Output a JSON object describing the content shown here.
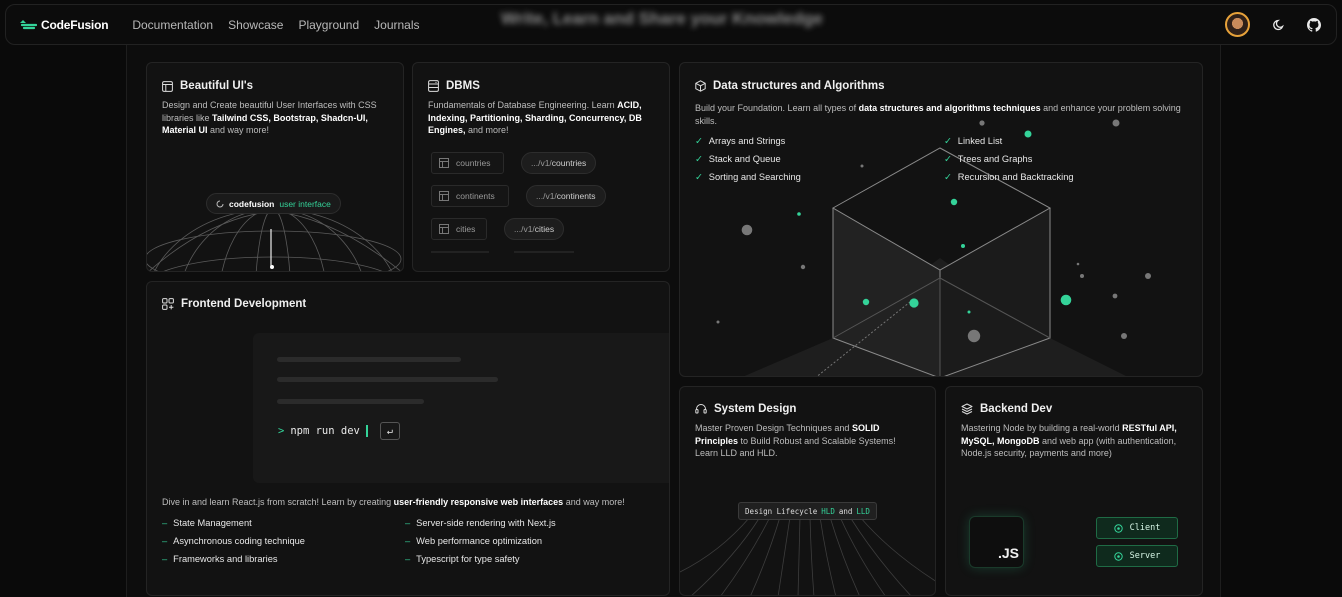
{
  "nav": {
    "brand": "CodeFusion",
    "links": [
      "Documentation",
      "Showcase",
      "Playground",
      "Journals"
    ],
    "hero_blurred": "Write, Learn and Share your Knowledge"
  },
  "cards": {
    "ui": {
      "title": "Beautiful UI's",
      "desc_pre": "Design and Create beautiful User Interfaces with CSS libraries like ",
      "desc_bold": "Tailwind CSS, Bootstrap, Shadcn-UI, Material UI",
      "desc_post": " and way more!",
      "badge_brand": "codefusion",
      "badge_accent": "user interface"
    },
    "dbms": {
      "title": "DBMS",
      "desc_pre": "Fundamentals of Database Engineering. Learn ",
      "desc_bold": "ACID, Indexing, Partitioning, Sharding, Concurrency, DB Engines,",
      "desc_post": " and more!",
      "tables": [
        "countries",
        "continents",
        "cities"
      ],
      "routes_prefix": ".../v1/",
      "routes": [
        "countries",
        "continents",
        "cities"
      ]
    },
    "dsa": {
      "title": "Data structures and Algorithms",
      "desc_pre": "Build your Foundation. Learn all types of ",
      "desc_bold": "data structures and algorithms techniques",
      "desc_post": " and enhance your problem solving skills.",
      "check": "✓",
      "topics_left": [
        "Arrays and Strings",
        "Stack and Queue",
        "Sorting and Searching"
      ],
      "topics_right": [
        "Linked List",
        "Trees and Graphs",
        "Recursion and Backtracking"
      ]
    },
    "frontend": {
      "title": "Frontend Development",
      "terminal_prompt": ">",
      "terminal_cmd": "npm run dev",
      "desc_pre": "Dive in and learn React.js from scratch! Learn by creating ",
      "desc_bold": "user-friendly responsive web interfaces",
      "desc_post": " and way more!",
      "dash": "–",
      "topics_left": [
        "State Management",
        "Asynchronous coding technique",
        "Frameworks and libraries"
      ],
      "topics_right": [
        "Server-side rendering with Next.js",
        "Web performance optimization",
        "Typescript for type safety"
      ]
    },
    "system": {
      "title": "System Design",
      "desc_pre": "Master Proven Design Techniques and ",
      "desc_bold": "SOLID Principles",
      "desc_post": " to Build Robust and Scalable Systems! Learn LLD and HLD.",
      "lifecycle_label": "Design Lifecycle",
      "lifecycle_hld": "HLD",
      "lifecycle_and": "and",
      "lifecycle_lld": "LLD"
    },
    "backend": {
      "title": "Backend Dev",
      "desc_pre": "Mastering Node by building a real-world ",
      "desc_bold": "RESTful API, MySQL, MongoDB",
      "desc_post": " and web app (with authentication, Node.js security, payments and more)",
      "js_label": ".JS",
      "client_label": "Client",
      "server_label": "Server"
    }
  },
  "colors": {
    "accent": "#34d399",
    "background": "#0a0a0a",
    "card": "#121212",
    "avatar_ring": "#e7a23a"
  }
}
